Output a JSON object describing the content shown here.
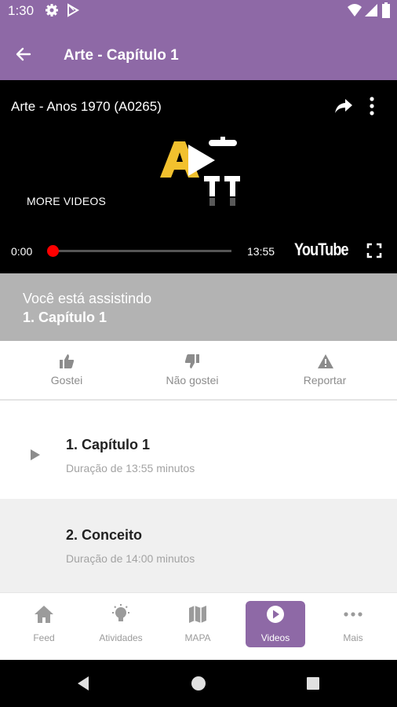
{
  "status_bar": {
    "time": "1:30"
  },
  "app_bar": {
    "title": "Arte - Capítulo 1"
  },
  "player": {
    "video_title": "Arte - Anos 1970 (A0265)",
    "more_videos": "MORE VIDEOS",
    "current_time": "0:00",
    "duration": "13:55",
    "youtube_label": "YouTube",
    "progress": 0
  },
  "now_watching": {
    "label": "Você está assistindo",
    "title": "1. Capítulo 1"
  },
  "actions": [
    {
      "label": "Gostei",
      "icon": "thumbs-up-icon"
    },
    {
      "label": "Não gostei",
      "icon": "thumbs-down-icon"
    },
    {
      "label": "Reportar",
      "icon": "warning-icon"
    }
  ],
  "videos": [
    {
      "title": "1. Capítulo 1",
      "duration": "Duração de 13:55 minutos",
      "playing": true
    },
    {
      "title": "2. Conceito",
      "duration": "Duração de 14:00 minutos",
      "playing": false
    }
  ],
  "bottom_nav": [
    {
      "label": "Feed",
      "icon": "home-icon"
    },
    {
      "label": "Atividades",
      "icon": "lightbulb-icon"
    },
    {
      "label": "MAPA",
      "icon": "map-icon"
    },
    {
      "label": "Videos",
      "icon": "play-circle-icon",
      "active": true
    },
    {
      "label": "Mais",
      "icon": "more-horizontal-icon"
    }
  ],
  "colors": {
    "primary": "#8e69a6",
    "watching_bg": "#b3b3b3",
    "progress": "#ff0000"
  }
}
